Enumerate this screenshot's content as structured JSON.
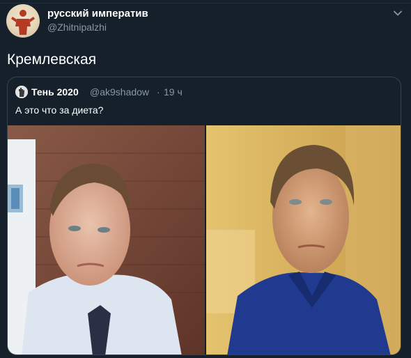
{
  "tweet": {
    "author_name": "русский императив",
    "author_handle": "@Zhitnipalzhi",
    "text": "Кремлевская",
    "avatar_icon": "avatar-silhouette-icon",
    "more_icon": "chevron-down-icon"
  },
  "quote": {
    "author_name": "Тень 2020",
    "author_handle": "@ak9shadow",
    "separator": "·",
    "time": "19 ч",
    "text": "А это что за диета?",
    "images": [
      "photo-before",
      "photo-after"
    ]
  },
  "colors": {
    "background": "#15202b",
    "secondary_text": "#8899a6",
    "border": "#38444d"
  }
}
